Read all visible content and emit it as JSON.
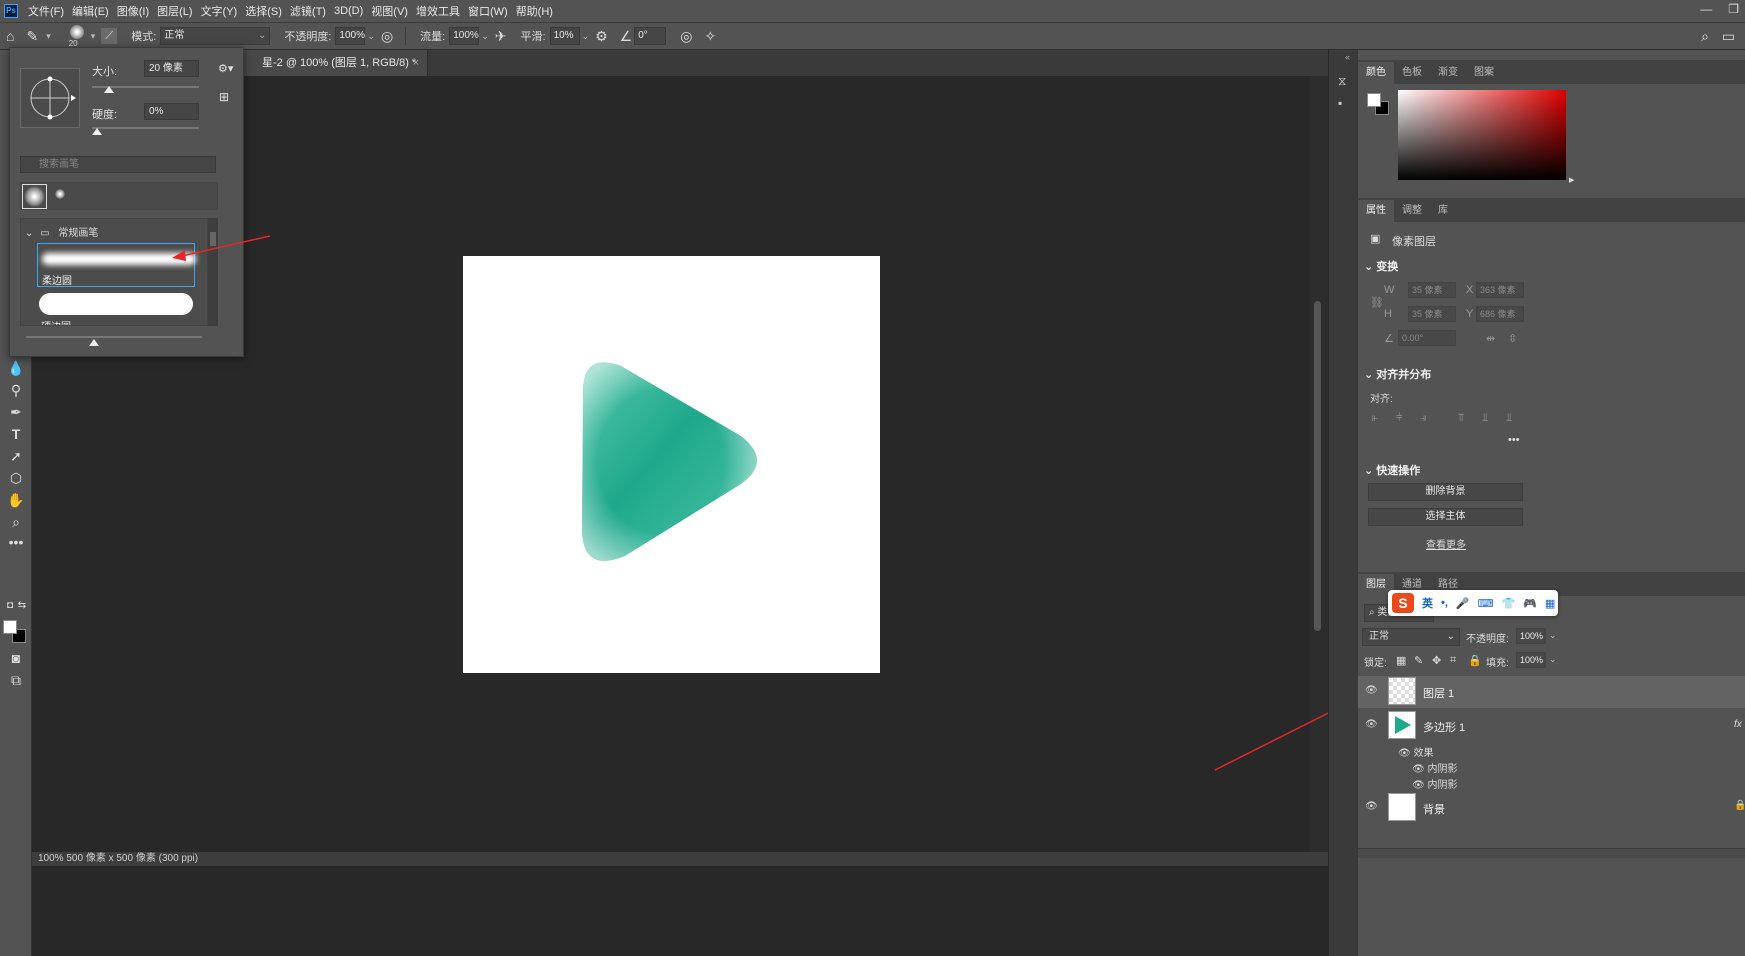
{
  "menubar": {
    "items": [
      "文件(F)",
      "编辑(E)",
      "图像(I)",
      "图层(L)",
      "文字(Y)",
      "选择(S)",
      "滤镜(T)",
      "3D(D)",
      "视图(V)",
      "增效工具",
      "窗口(W)",
      "帮助(H)"
    ]
  },
  "options": {
    "brush_size": "20",
    "mode_label": "模式:",
    "mode_value": "正常",
    "opacity_label": "不透明度:",
    "opacity_value": "100%",
    "flow_label": "流量:",
    "flow_value": "100%",
    "smooth_label": "平滑:",
    "smooth_value": "10%",
    "angle_value": "0°"
  },
  "document": {
    "tab_title": "星-2 @ 100% (图层 1, RGB/8) *",
    "status": "100%    500 像素 x 500 像素 (300 ppi)"
  },
  "brush_popup": {
    "size_label": "大小:",
    "size_value": "20 像素",
    "hardness_label": "硬度:",
    "hardness_value": "0%",
    "size_fraction": 0.04,
    "hardness_fraction": 0.0,
    "search_placeholder": "搜索画笔",
    "group_name": "常规画笔",
    "brushes": [
      {
        "name": "柔边圆"
      },
      {
        "name": "硬边圆"
      }
    ]
  },
  "right_panel": {
    "color_tabs": [
      "颜色",
      "色板",
      "渐变",
      "图案"
    ],
    "props_tabs": [
      "属性",
      "调整",
      "库"
    ],
    "pixel_layer": "像素图层",
    "transform": {
      "title": "变换",
      "w": "35 像素",
      "x": "363 像素",
      "h": "35 像素",
      "y": "686 像素",
      "angle": "0.00°"
    },
    "align": {
      "title": "对齐并分布",
      "label": "对齐:"
    },
    "quick": {
      "title": "快速操作",
      "remove_bg": "删除背景",
      "select_subject": "选择主体",
      "more": "查看更多"
    }
  },
  "layers_panel": {
    "tabs": [
      "图层",
      "通道",
      "路径"
    ],
    "filter_label": "类型",
    "blend_mode": "正常",
    "opacity_label": "不透明度:",
    "opacity_value": "100%",
    "lock_label": "锁定:",
    "fill_label": "填充:",
    "fill_value": "100%",
    "layers": [
      {
        "name": "图层 1"
      },
      {
        "name": "多边形 1"
      },
      {
        "name": "背景"
      }
    ],
    "effects_label": "效果",
    "effect_items": [
      "内阴影",
      "内阴影"
    ]
  },
  "ime": {
    "logo": "S",
    "lang": "英"
  },
  "colors": {
    "accent": "#31a8ff",
    "shape_green": "#1faa8c",
    "annotation_red": "#e8262a"
  }
}
